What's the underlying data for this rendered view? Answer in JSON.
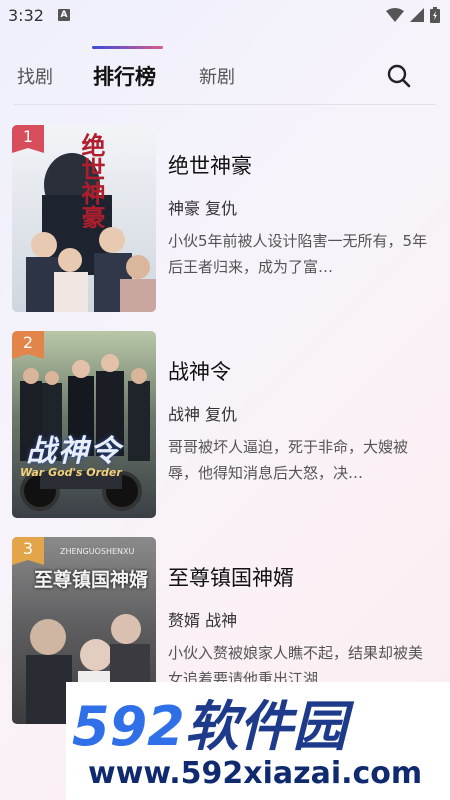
{
  "status_bar": {
    "time": "3:32",
    "notification_letter": "A"
  },
  "tabs": [
    {
      "label": "找剧",
      "active": false
    },
    {
      "label": "排行榜",
      "active": true
    },
    {
      "label": "新剧",
      "active": false
    }
  ],
  "search": {
    "icon": "search-icon"
  },
  "ranking": [
    {
      "rank": "1",
      "badge_color": "#d84d5b",
      "title": "绝世神豪",
      "tags": "神豪 复仇",
      "description": "小伙5年前被人设计陷害一无所有，5年后王者归来，成为了富…",
      "poster_text": "绝世神豪"
    },
    {
      "rank": "2",
      "badge_color": "#e3844a",
      "title": "战神令",
      "tags": "战神 复仇",
      "description": "哥哥被坏人逼迫，死于非命，大嫂被辱，他得知消息后大怒，决…",
      "poster_text": "战神令",
      "poster_subtext": "War God's Order"
    },
    {
      "rank": "3",
      "badge_color": "#e3a54a",
      "title": "至尊镇国神婿",
      "tags": "赘婿 战神",
      "description": "小伙入赘被娘家人瞧不起，结果却被美女追着要请他重出江湖…",
      "poster_text": "至尊镇国神婿",
      "poster_subtext": "ZHENGUOSHENXU"
    }
  ],
  "watermark": {
    "brand_number": "592",
    "brand_name": "软件园",
    "url": "www.592xiazai.com"
  }
}
